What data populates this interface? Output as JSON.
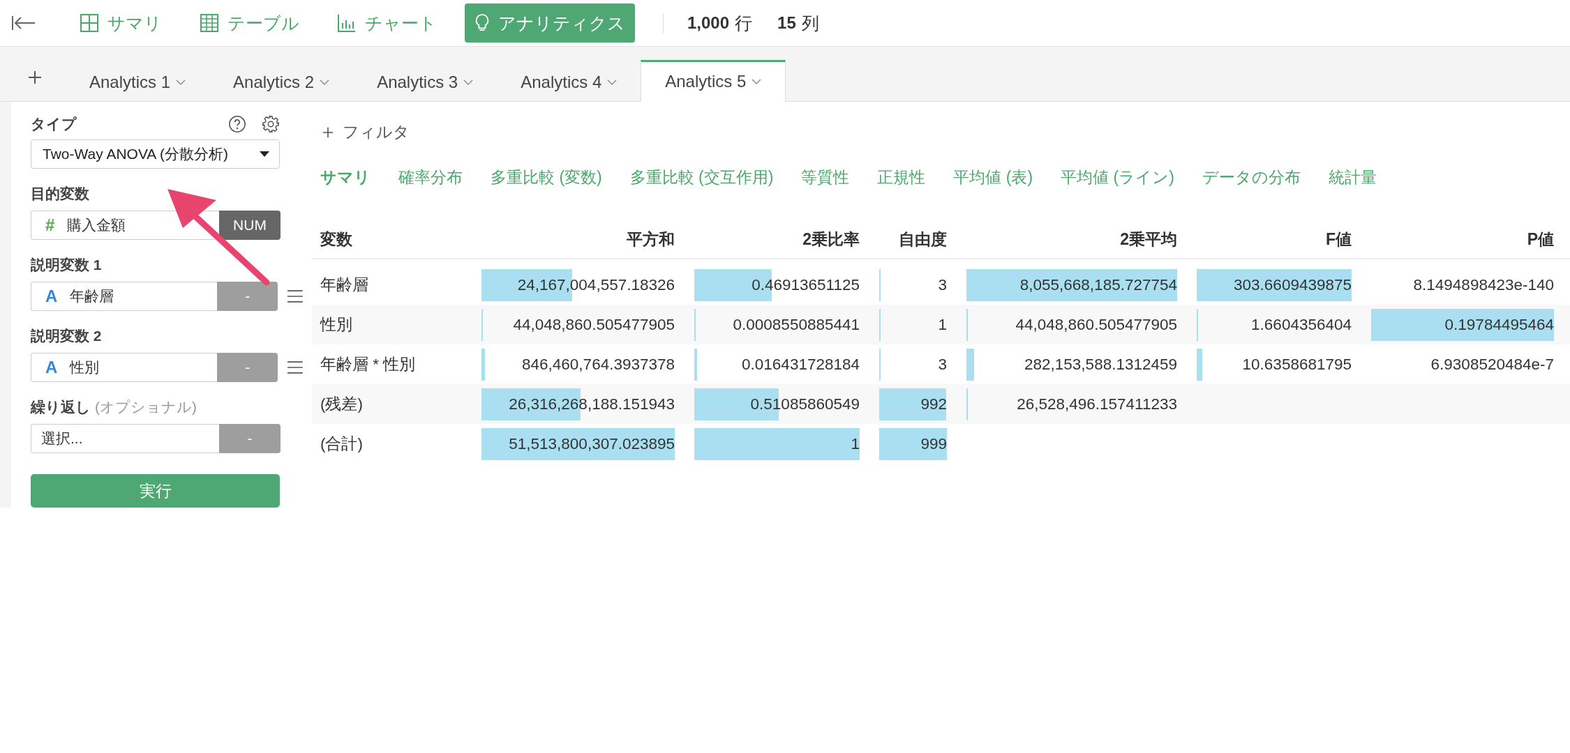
{
  "nav": {
    "items": [
      {
        "label": "サマリ",
        "kind": "summary",
        "selected": false
      },
      {
        "label": "テーブル",
        "kind": "table",
        "selected": false
      },
      {
        "label": "チャート",
        "kind": "chart",
        "selected": false
      },
      {
        "label": "アナリティクス",
        "kind": "bulb",
        "selected": true
      }
    ],
    "counts": [
      {
        "value": "1,000",
        "unit": "行"
      },
      {
        "value": "15",
        "unit": "列"
      }
    ]
  },
  "tabs": [
    {
      "label": "Analytics 1",
      "selected": false
    },
    {
      "label": "Analytics 2",
      "selected": false
    },
    {
      "label": "Analytics 3",
      "selected": false
    },
    {
      "label": "Analytics 4",
      "selected": false
    },
    {
      "label": "Analytics 5",
      "selected": true
    }
  ],
  "sidebar": {
    "type": {
      "label": "タイプ",
      "value": "Two-Way ANOVA (分散分析)"
    },
    "target": {
      "label": "目的変数",
      "symbol": "#",
      "value": "購入金額",
      "badge": "NUM"
    },
    "explanatory": [
      {
        "label": "説明変数 1",
        "symbol": "A",
        "value": "年齢層",
        "button": "-"
      },
      {
        "label": "説明変数 2",
        "symbol": "A",
        "value": "性別",
        "button": "-"
      }
    ],
    "repeat": {
      "label": "繰り返し",
      "note": "(オプショナル)",
      "placeholder": "選択...",
      "button": "-"
    },
    "run_button": "実行"
  },
  "filter": {
    "label": "フィルタ"
  },
  "subtabs": [
    {
      "label": "サマリ",
      "selected": true
    },
    {
      "label": "確率分布",
      "selected": false
    },
    {
      "label": "多重比較 (変数)",
      "selected": false
    },
    {
      "label": "多重比較 (交互作用)",
      "selected": false
    },
    {
      "label": "等質性",
      "selected": false
    },
    {
      "label": "正規性",
      "selected": false
    },
    {
      "label": "平均値 (表)",
      "selected": false
    },
    {
      "label": "平均値 (ライン)",
      "selected": false
    },
    {
      "label": "データの分布",
      "selected": false
    },
    {
      "label": "統計量",
      "selected": false
    }
  ],
  "table": {
    "columns": [
      "変数",
      "平方和",
      "2乗比率",
      "自由度",
      "2乗平均",
      "F値",
      "P値"
    ],
    "rows": [
      [
        "年齢層",
        "24,167,004,557.18326",
        "0.46913651125",
        "3",
        "8,055,668,185.727754",
        "303.6609439875",
        "8.1494898423e-140"
      ],
      [
        "性別",
        "44,048,860.505477905",
        "0.0008550885441",
        "1",
        "44,048,860.505477905",
        "1.6604356404",
        "0.19784495464"
      ],
      [
        "年齢層 * 性別",
        "846,460,764.3937378",
        "0.016431728184",
        "3",
        "282,153,588.1312459",
        "10.6358681795",
        "6.9308520484e-7"
      ],
      [
        "(残差)",
        "26,316,268,188.151943",
        "0.51085860549",
        "992",
        "26,528,496.157411233"
      ],
      [
        "(合計)",
        "51,513,800,307.023895",
        "1",
        "999"
      ]
    ]
  }
}
